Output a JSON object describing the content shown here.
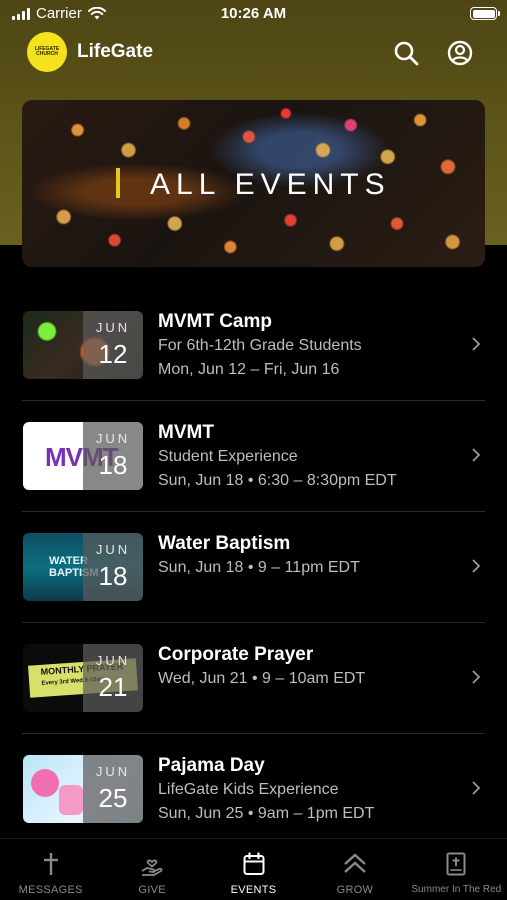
{
  "status_bar": {
    "carrier": "Carrier",
    "time": "10:26 AM"
  },
  "header": {
    "logo_text": "LIFEGATE CHURCH",
    "app_name": "LifeGate",
    "icons": [
      "search-icon",
      "account-icon"
    ]
  },
  "banner": {
    "title": "ALL EVENTS"
  },
  "events": [
    {
      "title": "MVMT Camp",
      "line1": "For 6th-12th Grade Students",
      "line2": "Mon, Jun 12 – Fri, Jun 16",
      "month": "JUN",
      "day": "12"
    },
    {
      "title": "MVMT",
      "line1": "Student Experience",
      "line2": "Sun, Jun 18 • 6:30 – 8:30pm EDT",
      "month": "JUN",
      "day": "18",
      "thumb_text": "MVMT"
    },
    {
      "title": "Water Baptism",
      "line1": "Sun, Jun 18 • 9 – 11pm EDT",
      "line2": "",
      "month": "JUN",
      "day": "18",
      "thumb_text": "WATER BAPTISM"
    },
    {
      "title": "Corporate Prayer",
      "line1": "Wed, Jun 21 • 9 – 10am EDT",
      "line2": "",
      "month": "JUN",
      "day": "21",
      "thumb_text": "MONTHLY PRAYER",
      "thumb_subtext": "Every 3rd Wed 9-10am"
    },
    {
      "title": "Pajama Day",
      "line1": "LifeGate Kids Experience",
      "line2": "Sun, Jun 25 • 9am – 1pm EDT",
      "month": "JUN",
      "day": "25"
    }
  ],
  "tabs": [
    {
      "label": "MESSAGES",
      "icon": "cross-icon",
      "active": false
    },
    {
      "label": "GIVE",
      "icon": "give-hand-icon",
      "active": false
    },
    {
      "label": "EVENTS",
      "icon": "calendar-icon",
      "active": true
    },
    {
      "label": "GROW",
      "icon": "grow-chevrons-icon",
      "active": false
    },
    {
      "label": "Summer In The Red",
      "icon": "bible-icon",
      "active": false
    }
  ],
  "colors": {
    "header_bg": "#5e5519",
    "logo_yellow": "#f4e31c",
    "banner_accent": "#e6c81c",
    "background": "#000000"
  }
}
